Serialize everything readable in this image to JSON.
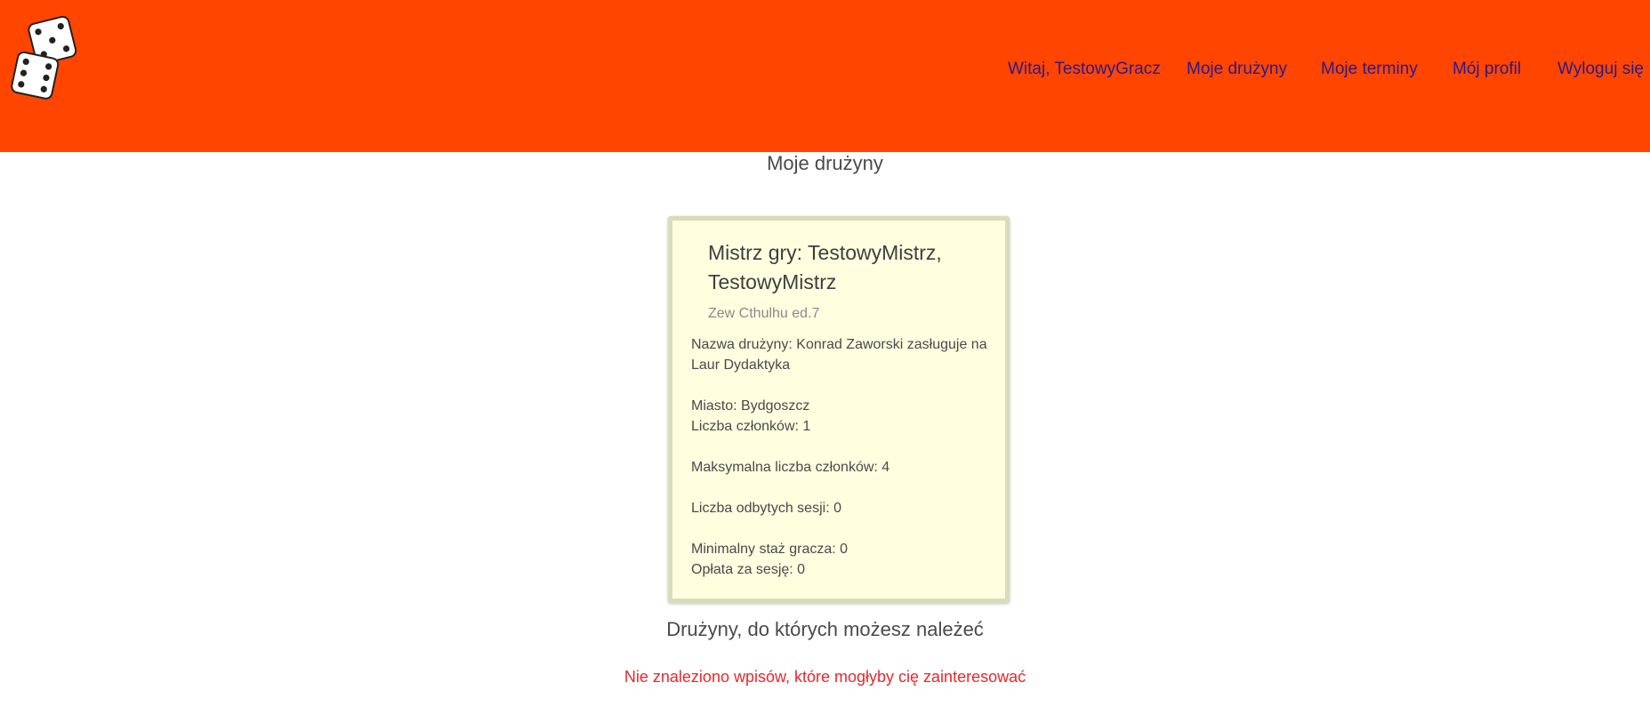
{
  "nav": {
    "greeting": "Witaj, TestowyGracz",
    "my_teams": "Moje drużyny",
    "my_dates": "Moje terminy",
    "my_profile": "Mój profil",
    "logout": "Wyloguj się"
  },
  "colors": {
    "header_bg": "#ff4500",
    "nav_link": "#2a1a8a",
    "card_bg": "#ffffe0",
    "empty_message": "#e8282b"
  },
  "icons": {
    "logo": "dice-icon"
  },
  "my_teams_title": "Moje drużyny",
  "team_card": {
    "gm_title": "Mistrz gry: TestowyMistrz, TestowyMistrz",
    "system": "Zew Cthulhu ed.7",
    "team_name": "Nazwa drużyny: Konrad Zaworski zasługuje na Laur Dydaktyka",
    "city": "Miasto: Bydgoszcz",
    "members": "Liczba członków: 1",
    "max_members": "Maksymalna liczba członków: 4",
    "sessions": "Liczba odbytych sesji: 0",
    "min_experience": "Minimalny staż gracza: 0",
    "fee": "Opłata za sesję: 0"
  },
  "available_teams_title": "Drużyny, do których możesz należeć",
  "empty_message": "Nie znaleziono wpisów, które mogłyby cię zainteresować"
}
